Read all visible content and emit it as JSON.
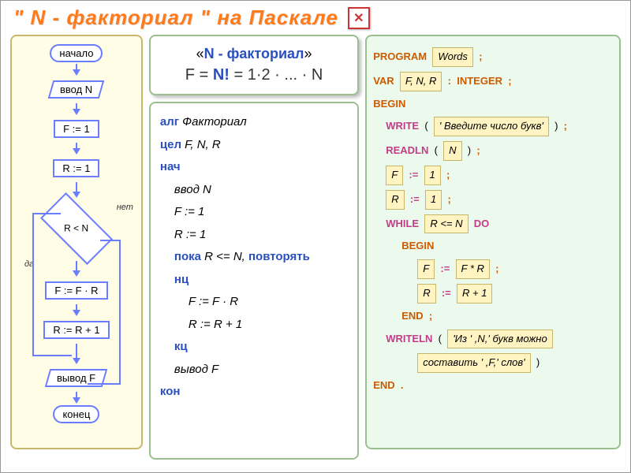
{
  "header": {
    "title": "\" N - факториал \"   на   Паскале",
    "close": "✕"
  },
  "flowchart": {
    "start": "начало",
    "input": "ввод  N",
    "step1": "F := 1",
    "step2": "R := 1",
    "decision": "R < N",
    "no_label": "нет",
    "yes_label": "да",
    "loop1": "F := F · R",
    "loop2": "R := R + 1",
    "output": "вывод  F",
    "end": "конец"
  },
  "formula": {
    "line1_prefix": "«",
    "line1_mid": "N - факториал",
    "line1_suffix": "»",
    "line2": "F = N! = 1·2 · ... · N"
  },
  "algo": {
    "l1_kw": "алг",
    "l1_txt": "  Факториал",
    "l2_kw": "цел",
    "l2_txt": "  F, N, R",
    "l3_kw": "нач",
    "l4": "ввод  N",
    "l5": "F := 1",
    "l6": "R := 1",
    "l7_kw": "пока",
    "l7_txt": "  R <= N, ",
    "l7_kw2": "повторять",
    "l8_kw": "нц",
    "l9": "F := F · R",
    "l10": "R := R + 1",
    "l11_kw": "кц",
    "l12": "вывод  F",
    "l13_kw": "кон"
  },
  "pascal": {
    "program_kw": "PROGRAM",
    "program_name": "Words",
    "var_kw": "VAR",
    "var_list": "F, N, R",
    "integer_kw": "INTEGER",
    "begin_kw": "BEGIN",
    "write_kw": "WRITE",
    "write_arg": "' Введите  число  букв'",
    "readln_kw": "READLN",
    "readln_arg": "N",
    "f_init_var": "F",
    "f_init_val": "1",
    "r_init_var": "R",
    "r_init_val": "1",
    "while_kw": "WHILE",
    "while_cond": "R <= N",
    "do_kw": "DO",
    "begin2_kw": "BEGIN",
    "loop_f_var": "F",
    "loop_f_val": "F * R",
    "loop_r_var": "R",
    "loop_r_val": "R + 1",
    "end1_kw": "END",
    "writeln_kw": "WRITELN",
    "writeln_arg1": "'Из ' ,N,' букв  можно",
    "writeln_arg2": "составить ' ,F,'  слов'",
    "end2_kw": "END",
    "colon": ":",
    "semi": ";",
    "dot": ".",
    "assign": ":="
  }
}
